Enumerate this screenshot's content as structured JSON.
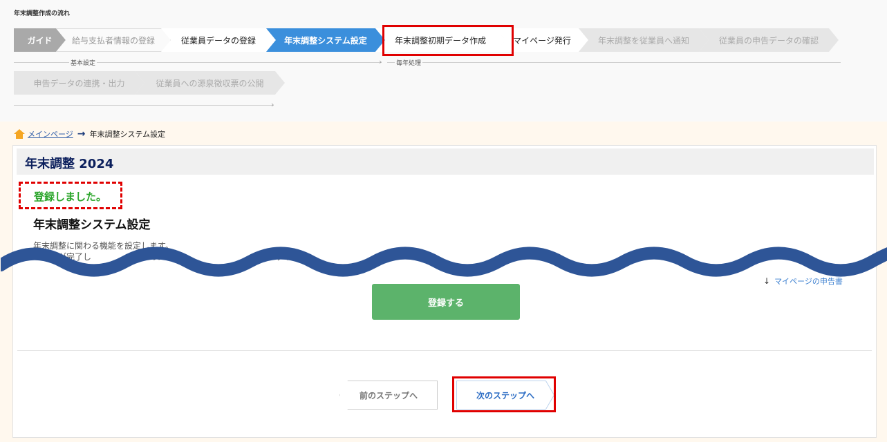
{
  "flow": {
    "title": "年末調整作成の流れ",
    "row1": [
      {
        "label": "ガイド",
        "state": "guide"
      },
      {
        "label": "給与支払者情報の登録",
        "state": "done"
      },
      {
        "label": "従業員データの登録",
        "state": "normal"
      },
      {
        "label": "年末調整システム設定",
        "state": "active"
      },
      {
        "label": "年末調整初期データ作成",
        "state": "normal"
      },
      {
        "label": "マイページ発行",
        "state": "normal"
      },
      {
        "label": "年末調整を従業員へ通知",
        "state": "later"
      },
      {
        "label": "従業員の申告データの確認",
        "state": "later"
      }
    ],
    "row2": [
      {
        "label": "申告データの連携・出力",
        "state": "later"
      },
      {
        "label": "従業員への源泉徴収票の公開",
        "state": "later"
      }
    ],
    "phase_basic": "基本設定",
    "phase_yearly": "毎年処理"
  },
  "breadcrumb": {
    "home": "メインページ",
    "current": "年末調整システム設定"
  },
  "panel": {
    "title": "年末調整 2024",
    "success": "登録しました。",
    "section_title": "年末調整システム設定",
    "desc_line1": "年末調整に関わる機能を設定します。",
    "desc_line2": "　　　が完了し　　　　　　　のステッ　　　　　　　　　　　みくだ",
    "right_link": "マイページの申告書",
    "register_button": "登録する",
    "prev_button": "前のステップへ",
    "next_button": "次のステップへ"
  },
  "colors": {
    "active_step": "#3b8fdc",
    "register_button": "#5cb36b",
    "success_text": "#2aa52a",
    "highlight": "#e00000",
    "wave": "#2e5597"
  }
}
